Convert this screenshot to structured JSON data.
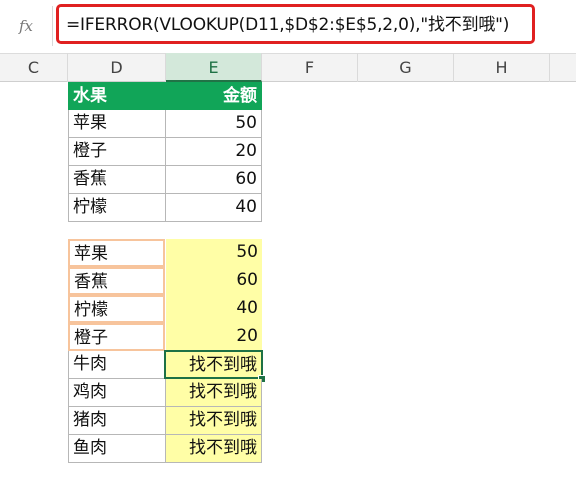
{
  "formula_bar": {
    "fx_label": "fx",
    "formula": "=IFERROR(VLOOKUP(D11,$D$2:$E$5,2,0),\"找不到哦\")"
  },
  "columns": [
    "C",
    "D",
    "E",
    "F",
    "G",
    "H"
  ],
  "source_table": {
    "headers": [
      "水果",
      "金额"
    ],
    "rows": [
      {
        "name": "苹果",
        "value": "50"
      },
      {
        "name": "橙子",
        "value": "20"
      },
      {
        "name": "香蕉",
        "value": "60"
      },
      {
        "name": "柠檬",
        "value": "40"
      }
    ]
  },
  "lookup_table": {
    "rows": [
      {
        "name": "苹果",
        "value": "50"
      },
      {
        "name": "香蕉",
        "value": "60"
      },
      {
        "name": "柠檬",
        "value": "40"
      },
      {
        "name": "橙子",
        "value": "20"
      },
      {
        "name": "牛肉",
        "value": "找不到哦"
      },
      {
        "name": "鸡肉",
        "value": "找不到哦"
      },
      {
        "name": "猪肉",
        "value": "找不到哦"
      },
      {
        "name": "鱼肉",
        "value": "找不到哦"
      }
    ]
  },
  "colors": {
    "header_green": "#11a558",
    "highlight_yellow": "#fffea6",
    "orange_border": "#f7c49c",
    "formula_border_red": "#e02020",
    "active_cell_green": "#1e7145"
  }
}
